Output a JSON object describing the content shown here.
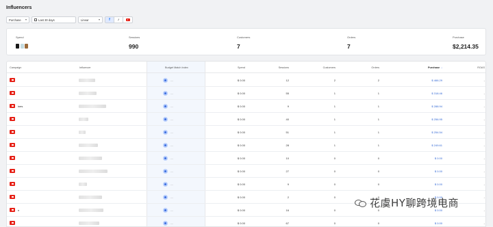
{
  "page": {
    "title": "Influencers"
  },
  "filters": {
    "event": "Purchase",
    "date_range": "Last 30 days",
    "model": "Linear",
    "social_icons": [
      "facebook-icon",
      "tiktok-icon",
      "youtube-icon"
    ],
    "facebook_glyph": "f",
    "tiktok_glyph": "♪"
  },
  "summary": {
    "spend_label": "Spend",
    "sessions_label": "Sessions",
    "sessions_value": "990",
    "customers_label": "Customers",
    "customers_value": "7",
    "orders_label": "Orders",
    "orders_value": "7",
    "purchase_label": "Purchase",
    "purchase_value": "$2,214.35",
    "spend_colors": [
      "#1a1a1a",
      "#c3dbe0",
      "#9b6a3a"
    ]
  },
  "table": {
    "headers": {
      "campaign": "Campaign",
      "influencer": "Influencer",
      "budget": "Budget Match Index",
      "spend": "Spend",
      "sessions": "Sessions",
      "customers": "Customers",
      "orders": "Orders",
      "purchase": "Purchase",
      "roas": "ROAS"
    },
    "sort_arrow": "↓",
    "placeholder_dash": "—",
    "rows": [
      {
        "campaign": "",
        "spend": "$ 0.00",
        "sessions": "12",
        "customers": "2",
        "orders": "2",
        "purchase": "$ 466.29",
        "roas": "-"
      },
      {
        "campaign": "",
        "spend": "$ 0.00",
        "sessions": "55",
        "customers": "1",
        "orders": "1",
        "purchase": "$ 318.46",
        "roas": "-"
      },
      {
        "campaign": "ines",
        "spend": "$ 0.00",
        "sessions": "9",
        "customers": "1",
        "orders": "1",
        "purchase": "$ 288.94",
        "roas": "-"
      },
      {
        "campaign": "",
        "spend": "$ 0.00",
        "sessions": "40",
        "customers": "1",
        "orders": "1",
        "purchase": "$ 256.95",
        "roas": "-"
      },
      {
        "campaign": "",
        "spend": "$ 0.00",
        "sessions": "51",
        "customers": "1",
        "orders": "1",
        "purchase": "$ 254.54",
        "roas": "-"
      },
      {
        "campaign": "",
        "spend": "$ 0.00",
        "sessions": "28",
        "customers": "1",
        "orders": "1",
        "purchase": "$ 249.61",
        "roas": "-"
      },
      {
        "campaign": "",
        "spend": "$ 0.00",
        "sessions": "10",
        "customers": "0",
        "orders": "0",
        "purchase": "$ 0.00",
        "roas": "-"
      },
      {
        "campaign": "",
        "spend": "$ 0.00",
        "sessions": "27",
        "customers": "0",
        "orders": "0",
        "purchase": "$ 0.00",
        "roas": "-"
      },
      {
        "campaign": "",
        "spend": "$ 0.00",
        "sessions": "9",
        "customers": "0",
        "orders": "0",
        "purchase": "$ 0.00",
        "roas": "-"
      },
      {
        "campaign": "",
        "spend": "$ 0.00",
        "sessions": "2",
        "customers": "0",
        "orders": "0",
        "purchase": "$ 0.00",
        "roas": "-"
      },
      {
        "campaign": "n",
        "spend": "$ 0.00",
        "sessions": "16",
        "customers": "0",
        "orders": "0",
        "purchase": "$ 0.00",
        "roas": "-"
      },
      {
        "campaign": "",
        "spend": "$ 0.00",
        "sessions": "67",
        "customers": "0",
        "orders": "0",
        "purchase": "$ 0.00",
        "roas": "-"
      }
    ]
  },
  "watermark": {
    "text": "花虞HY聊跨境电商"
  }
}
